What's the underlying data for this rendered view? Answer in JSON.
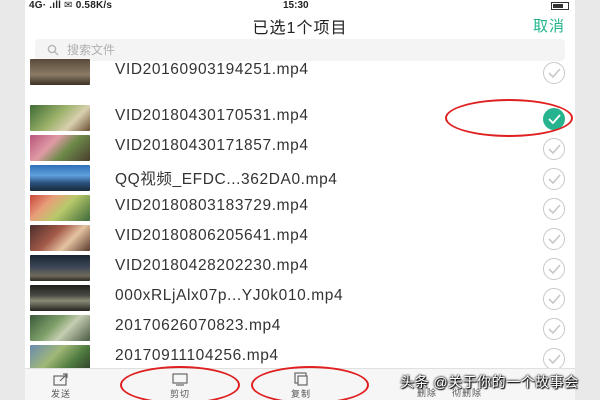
{
  "status_bar": {
    "left": "4G· .ıll ✉ 0.58K/s",
    "time": "15:30"
  },
  "header": {
    "title": "已选1个项目",
    "cancel_label": "取消"
  },
  "search": {
    "placeholder": "搜索文件"
  },
  "files": [
    {
      "name": "VID20160903194251.mp4",
      "selected": false
    },
    {
      "name": "VID20180430170531.mp4",
      "selected": true
    },
    {
      "name": "VID20180430171857.mp4",
      "selected": false
    },
    {
      "name": "QQ视频_EFDC...362DA0.mp4",
      "selected": false
    },
    {
      "name": "VID20180803183729.mp4",
      "selected": false
    },
    {
      "name": "VID20180806205641.mp4",
      "selected": false
    },
    {
      "name": "VID20180428202230.mp4",
      "selected": false
    },
    {
      "name": "000xRLjAlx07p...YJ0k010.mp4",
      "selected": false
    },
    {
      "name": "20170626070823.mp4",
      "selected": false
    },
    {
      "name": "20170911104256.mp4",
      "selected": false
    }
  ],
  "toolbar": {
    "send_label": "发送",
    "cut_label": "剪切",
    "copy_label": "复制",
    "delete_label": "删除",
    "delete_all_label": "彻删除"
  },
  "watermark": "头条 @关于你的一个故事会",
  "colors": {
    "accent": "#28b38f",
    "annotation": "#e02020"
  }
}
